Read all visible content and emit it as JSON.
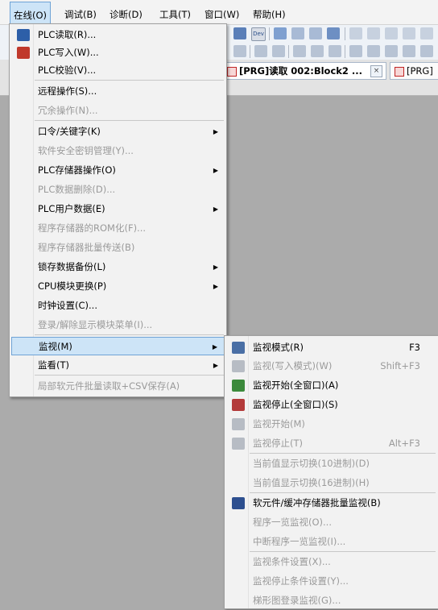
{
  "menubar": {
    "items": [
      {
        "label": "在线(O)"
      },
      {
        "label": "调试(B)"
      },
      {
        "label": "诊断(D)"
      },
      {
        "label": "工具(T)"
      },
      {
        "label": "窗口(W)"
      },
      {
        "label": "帮助(H)"
      }
    ]
  },
  "toolbar": {
    "dev_label": "Dev"
  },
  "tabs": [
    {
      "label": "[PRG]读取 002:Block2 ...",
      "close": "×"
    },
    {
      "label": "[PRG]",
      "close": ""
    }
  ],
  "online_menu": {
    "items": [
      {
        "label": "PLC读取(R)...",
        "enabled": true,
        "submenu": false,
        "icon": "plc-read-icon"
      },
      {
        "label": "PLC写入(W)...",
        "enabled": true,
        "submenu": false,
        "icon": "plc-write-icon"
      },
      {
        "label": "PLC校验(V)...",
        "enabled": true,
        "submenu": false
      },
      {
        "label": "远程操作(S)...",
        "enabled": true,
        "submenu": false
      },
      {
        "label": "冗余操作(N)...",
        "enabled": false,
        "submenu": false
      },
      {
        "label": "口令/关键字(K)",
        "enabled": true,
        "submenu": true
      },
      {
        "label": "软件安全密钥管理(Y)...",
        "enabled": false,
        "submenu": false
      },
      {
        "label": "PLC存储器操作(O)",
        "enabled": true,
        "submenu": true
      },
      {
        "label": "PLC数据删除(D)...",
        "enabled": false,
        "submenu": false
      },
      {
        "label": "PLC用户数据(E)",
        "enabled": true,
        "submenu": true
      },
      {
        "label": "程序存储器的ROM化(F)...",
        "enabled": false,
        "submenu": false
      },
      {
        "label": "程序存储器批量传送(B)",
        "enabled": false,
        "submenu": false
      },
      {
        "label": "锁存数据备份(L)",
        "enabled": true,
        "submenu": true
      },
      {
        "label": "CPU模块更换(P)",
        "enabled": true,
        "submenu": true
      },
      {
        "label": "时钟设置(C)...",
        "enabled": true,
        "submenu": false
      },
      {
        "label": "登录/解除显示模块菜单(I)...",
        "enabled": false,
        "submenu": false
      },
      {
        "label": "监视(M)",
        "enabled": true,
        "submenu": true,
        "highlighted": true
      },
      {
        "label": "监看(T)",
        "enabled": true,
        "submenu": true
      },
      {
        "label": "局部软元件批量读取+CSV保存(A)",
        "enabled": false,
        "submenu": false
      }
    ]
  },
  "monitor_submenu": {
    "items": [
      {
        "label": "监视模式(R)",
        "shortcut": "F3",
        "enabled": true,
        "icon": "monitor-mode-icon"
      },
      {
        "label": "监视(写入模式)(W)",
        "shortcut": "Shift+F3",
        "enabled": false,
        "icon": "monitor-write-mode-icon"
      },
      {
        "label": "监视开始(全窗口)(A)",
        "shortcut": "",
        "enabled": true,
        "icon": "monitor-start-all-icon"
      },
      {
        "label": "监视停止(全窗口)(S)",
        "shortcut": "",
        "enabled": true,
        "icon": "monitor-stop-all-icon"
      },
      {
        "label": "监视开始(M)",
        "shortcut": "",
        "enabled": false,
        "icon": "monitor-start-icon"
      },
      {
        "label": "监视停止(T)",
        "shortcut": "Alt+F3",
        "enabled": false,
        "icon": "monitor-stop-icon"
      },
      {
        "label": "当前值显示切换(10进制)(D)",
        "shortcut": "",
        "enabled": false
      },
      {
        "label": "当前值显示切换(16进制)(H)",
        "shortcut": "",
        "enabled": false
      },
      {
        "label": "软元件/缓冲存储器批量监视(B)",
        "shortcut": "",
        "enabled": true,
        "icon": "device-batch-monitor-icon"
      },
      {
        "label": "程序一览监视(O)...",
        "shortcut": "",
        "enabled": false
      },
      {
        "label": "中断程序一览监视(I)...",
        "shortcut": "",
        "enabled": false
      },
      {
        "label": "监视条件设置(X)...",
        "shortcut": "",
        "enabled": false
      },
      {
        "label": "监视停止条件设置(Y)...",
        "shortcut": "",
        "enabled": false
      },
      {
        "label": "梯形图登录监视(G)...",
        "shortcut": "",
        "enabled": false
      }
    ]
  },
  "colors": {
    "highlight": "#cde4f7",
    "highlight_border": "#6fa3d6",
    "disabled_text": "#9a9a9a",
    "workspace": "#ababab"
  }
}
